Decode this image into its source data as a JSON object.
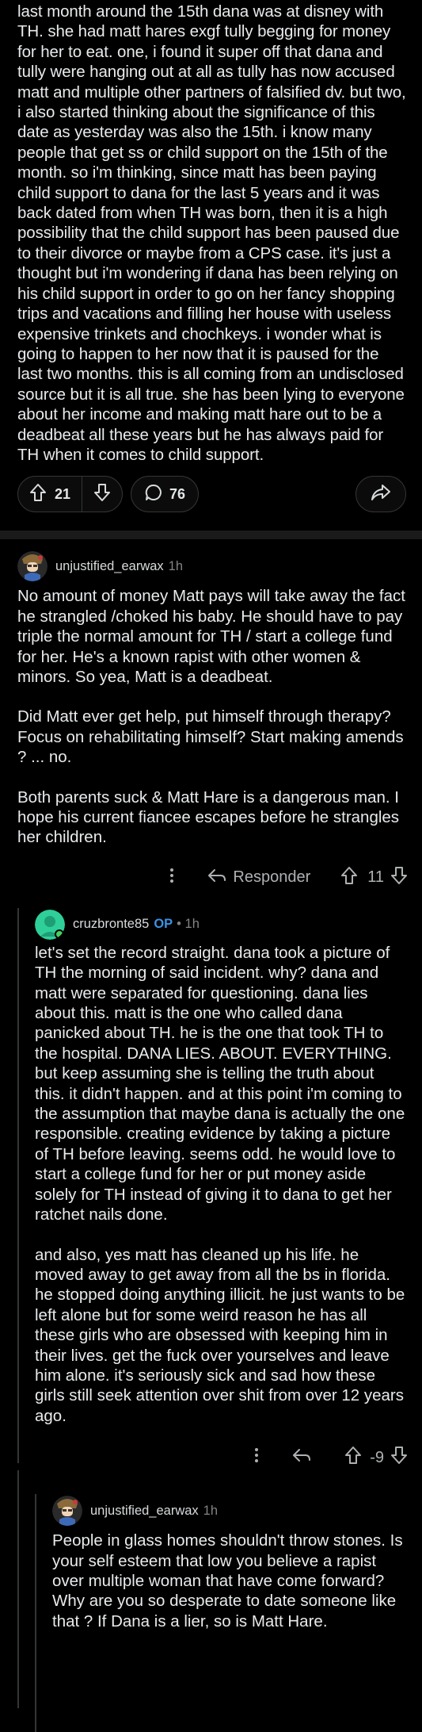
{
  "post": {
    "body": "last month around the 15th dana was at disney with TH. she had matt hares exgf tully begging for money for her to eat. one, i found it super off that dana and tully were hanging out at all as tully has now accused matt and multiple other partners of falsified dv. but two, i also started thinking about the significance of this date as yesterday was also the 15th. i know many people that get ss or child support on the 15th of the month. so i'm thinking, since matt has been paying child support to dana for the last 5 years and it was back dated from when TH was born, then it is a high possibility that the child support has been paused due to their divorce or maybe from a CPS case. it's just a thought but i'm wondering if dana has been relying on his child support in order to go on her fancy shopping trips and vacations and filling her house with useless expensive trinkets and chochkeys. i wonder what is going to happen to her now that it is paused for the last two months. this is all coming from an undisclosed source but it is all true. she has been lying to everyone about her income and making matt hare out to be a deadbeat all these years but he has always paid for TH when it comes to child support.",
    "upvotes": "21",
    "comments": "76"
  },
  "comments": [
    {
      "username": "unjustified_earwax",
      "time": "1h",
      "paragraphs": [
        "No amount of money Matt pays will take away the fact he strangled /choked his baby. He should have to pay triple the normal amount for TH / start a college fund for her. He's a known rapist with other women & minors.  So yea, Matt is a deadbeat.",
        "Did Matt ever get help, put himself through therapy? Focus on rehabilitating himself? Start making amends ? ... no.",
        "Both parents suck & Matt Hare is a dangerous man. I hope his current fiancee escapes before he strangles her children."
      ],
      "reply_label": "Responder",
      "score": "11"
    },
    {
      "username": "cruzbronte85",
      "op_badge": "OP",
      "time": "• 1h",
      "paragraphs": [
        "let's set the record straight. dana took a picture of TH the morning of said incident. why? dana and matt were separated for questioning. dana lies about this. matt is the one who called dana panicked about TH. he is the one that took TH to the hospital. DANA LIES. ABOUT. EVERYTHING. but keep assuming she is telling the truth about this. it didn't happen. and at this point i'm coming to the assumption that maybe dana is actually the one responsible. creating evidence by taking a picture of TH before leaving. seems odd. he would love to start a college fund for her or put money aside solely for TH instead of giving it to dana to get her ratchet nails done.",
        "and also, yes matt has cleaned up his life. he moved away to get away from all the bs in florida. he stopped doing anything illicit. he just wants to be left alone but for some weird reason he has all these girls who are obsessed with keeping him in their lives. get the fuck over yourselves and leave him alone. it's seriously sick and sad how these girls still seek attention over shit from over 12 years ago."
      ],
      "score": "-9"
    },
    {
      "username": "unjustified_earwax",
      "time": "1h",
      "paragraphs": [
        "People in glass homes shouldn't throw stones. Is your self esteem that low you believe a rapist over multiple woman that have come forward? Why are you so desperate to date someone like that ? If Dana is a lier, so is Matt Hare."
      ]
    }
  ]
}
